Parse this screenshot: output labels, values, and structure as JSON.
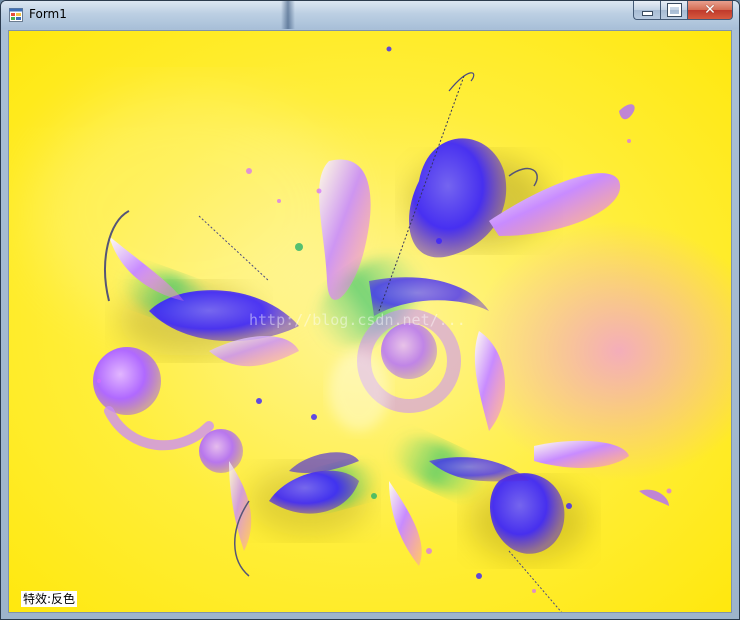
{
  "window": {
    "title": "Form1",
    "icon": "app-icon",
    "controls": {
      "minimize": "minimize-icon",
      "maximize": "maximize-icon",
      "close": "close-icon"
    }
  },
  "content": {
    "image": "abstract-floral-swirl-artwork",
    "watermark": "http://blog.csdn.net/...",
    "effect_label": "特效:反色"
  },
  "colors": {
    "background": "#ffec1a",
    "blue": "#3a2cff",
    "purple": "#b56bff",
    "magenta": "#ff6bd6",
    "green": "#36c46a"
  }
}
